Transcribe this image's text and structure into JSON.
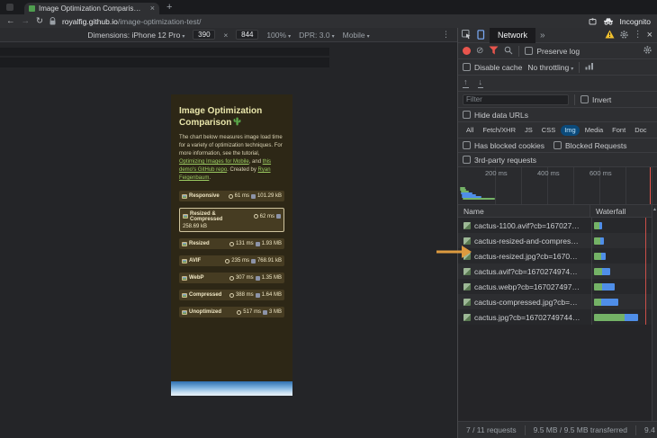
{
  "glyphs": {
    "back": "←",
    "forward": "→",
    "reload": "↻",
    "new_tab": "+",
    "close": "×",
    "kebab": "⋮",
    "more": "»",
    "clear": "⊘",
    "caret": "▾",
    "up": "↑",
    "down": "↓",
    "scroll_up": "▲",
    "times": "×"
  },
  "browser": {
    "tab_title": "Image Optimization Comparis…",
    "url_domain": "royalfig.github.io",
    "url_path": "/image-optimization-test/",
    "incognito_label": "Incognito"
  },
  "device_toolbar": {
    "dimensions_label": "Dimensions: iPhone 12 Pro",
    "width": "390",
    "height": "844",
    "zoom": "100%",
    "dpr": "DPR: 3.0",
    "mode": "Mobile"
  },
  "page": {
    "title": "Image Optimization Comparison",
    "intro_1": "The chart below measures image load time for a variety of optimization techniques. For more information, see the tutorial, ",
    "intro_link_1": "Optimizing Images for Mobile",
    "intro_2": ", and ",
    "intro_link_2": "this demo's GitHub repo",
    "intro_3": ". Created by ",
    "intro_link_3": "Ryan Feigenbaum",
    "intro_4": ".",
    "rows": [
      {
        "label": "Responsive",
        "time": "61 ms",
        "size": "101.29 kB"
      },
      {
        "label": "Resized & Compressed",
        "time": "62 ms",
        "size": "258.69 kB"
      },
      {
        "label": "Resized",
        "time": "131 ms",
        "size": "1.93 MB"
      },
      {
        "label": "AVIF",
        "time": "235 ms",
        "size": "768.91 kB"
      },
      {
        "label": "WebP",
        "time": "307 ms",
        "size": "1.35 MB"
      },
      {
        "label": "Compressed",
        "time": "388 ms",
        "size": "1.64 MB"
      },
      {
        "label": "Unoptimized",
        "time": "517 ms",
        "size": "3 MB"
      }
    ]
  },
  "devtools": {
    "panel_tab": "Network",
    "preserve_log": "Preserve log",
    "disable_cache": "Disable cache",
    "throttling": "No throttling",
    "filter_placeholder": "Filter",
    "invert": "Invert",
    "hide_data_urls": "Hide data URLs",
    "pills": [
      "All",
      "Fetch/XHR",
      "JS",
      "CSS",
      "Img",
      "Media",
      "Font",
      "Doc"
    ],
    "selected_pill": "Img",
    "has_blocked_cookies": "Has blocked cookies",
    "blocked_requests": "Blocked Requests",
    "third_party": "3rd-party requests",
    "timeline": {
      "ticks": [
        "200 ms",
        "400 ms",
        "600 ms"
      ],
      "bars": [
        {
          "x": 2,
          "y": 22,
          "w": 6,
          "c": "green"
        },
        {
          "x": 2,
          "y": 24,
          "w": 7,
          "c": "green"
        },
        {
          "x": 3,
          "y": 26,
          "w": 9,
          "c": "green"
        },
        {
          "x": 3,
          "y": 28,
          "w": 13,
          "c": "blue"
        },
        {
          "x": 4,
          "y": 30,
          "w": 16,
          "c": "blue"
        },
        {
          "x": 4,
          "y": 32,
          "w": 22,
          "c": "blue"
        },
        {
          "x": 5,
          "y": 34,
          "w": 36,
          "c": "green"
        }
      ]
    },
    "name_header": "Name",
    "waterfall_header": "Waterfall",
    "requests": [
      {
        "name": "cactus-1100.avif?cb=167027…",
        "waterfall": {
          "offset": 2,
          "green": 6,
          "blue": 3
        }
      },
      {
        "name": "cactus-resized-and-compres…",
        "waterfall": {
          "offset": 2,
          "green": 7,
          "blue": 4
        }
      },
      {
        "name": "cactus-resized.jpg?cb=1670…",
        "waterfall": {
          "offset": 2,
          "green": 8,
          "blue": 5
        }
      },
      {
        "name": "cactus.avif?cb=1670274974…",
        "waterfall": {
          "offset": 2,
          "green": 9,
          "blue": 9
        }
      },
      {
        "name": "cactus.webp?cb=167027497…",
        "waterfall": {
          "offset": 2,
          "green": 9,
          "blue": 14
        }
      },
      {
        "name": "cactus-compressed.jpg?cb=…",
        "waterfall": {
          "offset": 2,
          "green": 8,
          "blue": 19
        }
      },
      {
        "name": "cactus.jpg?cb=16702749744…",
        "waterfall": {
          "offset": 2,
          "green": 34,
          "blue": 15
        }
      }
    ],
    "status": {
      "requests": "7 / 11 requests",
      "transferred": "9.5 MB / 9.5 MB transferred",
      "resources": "9.4"
    }
  },
  "colors": {
    "accent_blue": "#7cacf8",
    "record_red": "#e8554d",
    "waterfall_green": "#74b266",
    "waterfall_blue": "#4f8ee8",
    "selected_pill_bg": "#0b4a7a",
    "annotation_orange": "#dd9a3f",
    "link_green": "#9ccc62"
  }
}
